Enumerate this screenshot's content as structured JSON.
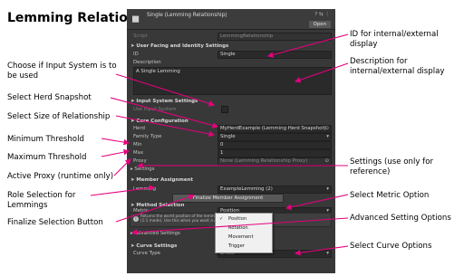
{
  "title": "Lemming Relationship Asset",
  "annotations": {
    "input_system": "Choose if Input System is to be used",
    "herd_snapshot": "Select Herd Snapshot",
    "size": "Select Size of Relationship",
    "min": "Minimum Threshold",
    "max": "Maximum Threshold",
    "proxy": "Active Proxy (runtime only)",
    "role": "Role Selection for Lemmings",
    "finalize": "Finalize Selection Button",
    "id": "ID for internal/external display",
    "description": "Description for internal/external display",
    "settings": "Settings (use only for reference)",
    "metric": "Select Metric Option",
    "advanced": "Advanced Setting Options",
    "curve": "Select Curve Options"
  },
  "inspector": {
    "header_title": "Single (Lemming Relationship)",
    "header_tools": "? ⇆ ⋮",
    "open_label": "Open",
    "script_label": "Script",
    "script_value": "LemmingRelationship",
    "sec_user_facing": "➤ User Facing and Identity Settings",
    "id_label": "ID",
    "id_value": "Single",
    "description_label": "Description",
    "description_value": "A Single Lemming",
    "sec_input_system": "➤ Input System Settings",
    "use_input_system_label": "Use Input System",
    "sec_core": "➤ Core Configuration",
    "herd_label": "Herd",
    "herd_value": "MyHerdExample (Lemming Herd Snapshot)",
    "family_type_label": "Family Type",
    "family_type_value": "Single",
    "min_label": "Min",
    "min_value": "0",
    "max_label": "Max",
    "max_value": "1",
    "proxy_label": "Proxy",
    "proxy_value": "None (Lemming Relationship Proxy)",
    "settings_label": "▸ Settings",
    "sec_member": "➤ Member Assignment",
    "lemming_label": "Lemming",
    "lemming_value": "ExampleLemming (2)",
    "finalize_label": "Finalize Member Assignment",
    "sec_method": "➤ Method Selection",
    "metric_label": "Metric",
    "metric_value": "Position",
    "help_text_1": "Returns the world position of the lemming as a single axis X, Y, or Z",
    "help_text_2": "(1:1 mode). Use this when you want a one-to-one value.",
    "advanced_label": "▸ Advanced Settings",
    "sec_curve": "➤ Curve Settings",
    "curve_type_label": "Curve Type",
    "curve_type_value": "Linear",
    "metric_options": [
      "Position",
      "Rotation",
      "Movement",
      "Trigger"
    ],
    "metric_selected": "Position"
  }
}
